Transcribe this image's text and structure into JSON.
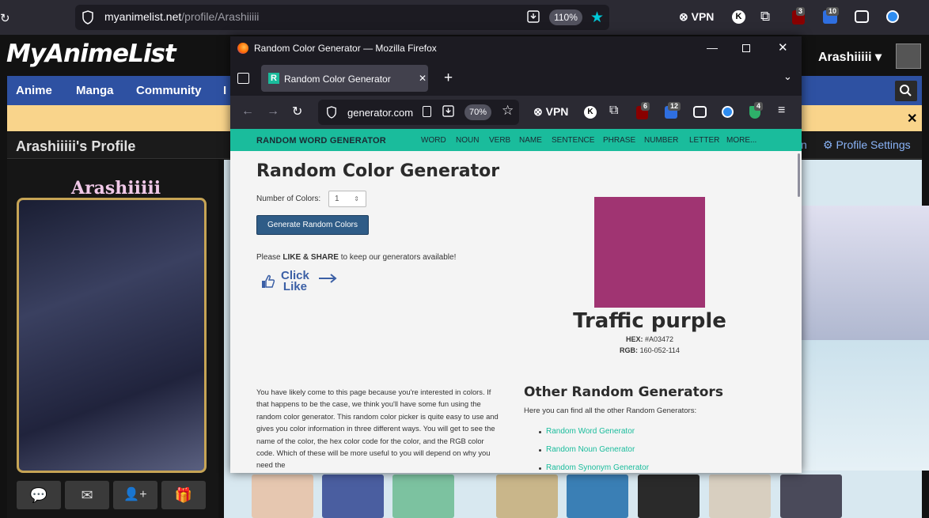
{
  "background_browser": {
    "url_host": "myanimelist.net",
    "url_path": "/profile/Arashiiiii",
    "zoom": "110%",
    "vpn_label": "VPN",
    "badges": [
      "3",
      "10"
    ]
  },
  "mal": {
    "logo": "MyAnimeList",
    "username": "Arashiiiii",
    "nav": [
      "Anime",
      "Manga",
      "Community",
      "I"
    ],
    "profile_title": "Arashiiiii's Profile",
    "profile_settings": "Profile Settings",
    "settings_prefix": "n",
    "picture_name": "Arashiiiii"
  },
  "firefox": {
    "window_title": "Random Color Generator — Mozilla Firefox",
    "tab_title": "Random Color Generator",
    "url": "generator.com",
    "zoom": "70%",
    "vpn_label": "VPN",
    "badges": [
      "6",
      "12",
      "4"
    ]
  },
  "site": {
    "brand": "RANDOM WORD GENERATOR",
    "nav": [
      "WORD",
      "NOUN",
      "VERB",
      "NAME",
      "SENTENCE",
      "PHRASE",
      "NUMBER",
      "LETTER",
      "MORE..."
    ],
    "title": "Random Color Generator",
    "num_colors_label": "Number of Colors:",
    "num_colors_value": "1",
    "generate_button": "Generate Random Colors",
    "share_prefix": "Please ",
    "share_bold": "LIKE & SHARE",
    "share_suffix": " to keep our generators available!",
    "click_like_line1": "Click",
    "click_like_line2": "Like",
    "color": {
      "name": "Traffic purple",
      "hex_label": "HEX:",
      "hex": "#A03472",
      "rgb_label": "RGB:",
      "rgb": "160-052-114",
      "swatch": "#a03472"
    },
    "paragraph": "You have likely come to this page because you're interested in colors. If that happens to be the case, we think you'll have some fun using the random color generator. This random color picker is quite easy to use and gives you color information in three different ways. You will get to see the name of the color, the hex color code for the color, and the RGB color code. Which of these will be more useful to you will depend on why you need the",
    "other_title": "Other Random Generators",
    "other_sub": "Here you can find all the other Random Generators:",
    "links": [
      "Random Word Generator",
      "Random Noun Generator",
      "Random Synonym Generator"
    ]
  },
  "colors": {
    "accent": "#1abc9c",
    "button": "#2f5c87",
    "mal_nav": "#2e51a2",
    "banner": "#f9d48b"
  }
}
